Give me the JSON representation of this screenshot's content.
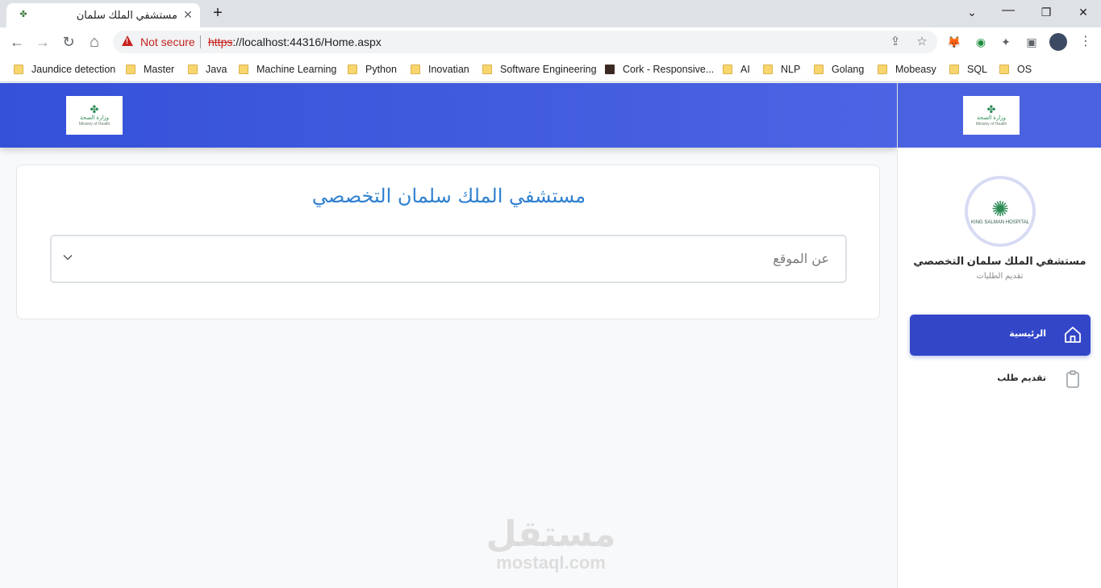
{
  "browser": {
    "tab": {
      "title": "مستشفي الملك سلمان",
      "close": "✕"
    },
    "new_tab": "+",
    "window_controls": {
      "minimize": "⌄",
      "restore": "❐",
      "close": "✕"
    },
    "nav": {
      "back": "←",
      "forward": "→",
      "reload": "↻",
      "home": "⌂"
    },
    "security_label": "Not secure",
    "url": {
      "scheme": "https",
      "rest": "://localhost:44316/Home.aspx"
    },
    "omnibox_icons": {
      "share": "⇪",
      "star": "☆"
    },
    "extensions": {
      "fox": "🦊",
      "bot": "◉",
      "puzzle": "✦",
      "panel": "▣"
    },
    "menu": "⋮",
    "bookmarks": [
      {
        "label": "Jaundice detection",
        "icon": "folder-icon"
      },
      {
        "label": "Master",
        "icon": "folder-icon"
      },
      {
        "label": "Java",
        "icon": "folder-icon"
      },
      {
        "label": "Machine Learning",
        "icon": "folder-icon"
      },
      {
        "label": "Python",
        "icon": "folder-icon"
      },
      {
        "label": "Inovatian",
        "icon": "folder-icon"
      },
      {
        "label": "Software Engineering",
        "icon": "folder-icon"
      },
      {
        "label": "Cork - Responsive...",
        "icon": "site-icon"
      },
      {
        "label": "AI",
        "icon": "folder-icon"
      },
      {
        "label": "NLP",
        "icon": "folder-icon"
      },
      {
        "label": "Golang",
        "icon": "folder-icon"
      },
      {
        "label": "Mobeasy",
        "icon": "folder-icon"
      },
      {
        "label": "SQL",
        "icon": "folder-icon"
      },
      {
        "label": "OS",
        "icon": "folder-icon"
      }
    ]
  },
  "header_logo": {
    "mark": "✤",
    "text": "وزارة الصحة",
    "sub": "Ministry of Health"
  },
  "sidebar": {
    "hospital_logo": {
      "mark": "✺",
      "text": "KING SALMAN HOSPITAL"
    },
    "title": "مستشفي الملك سلمان التخصصي",
    "subtitle": "تقديم الطلبات",
    "items": [
      {
        "label": "الرئيسية",
        "icon": "home-icon",
        "active": true
      },
      {
        "label": "تقديم طلب",
        "icon": "clipboard-icon",
        "active": false
      }
    ]
  },
  "main": {
    "title": "مستشفي الملك سلمان التخصصي",
    "accordion_label": "عن الموقع"
  },
  "watermark": {
    "arabic": "مستقل",
    "latin": "mostaql.com"
  },
  "colors": {
    "header": "#3f5ade",
    "active_nav": "#3346c8",
    "title": "#2f80d0",
    "danger": "#c5221f"
  }
}
